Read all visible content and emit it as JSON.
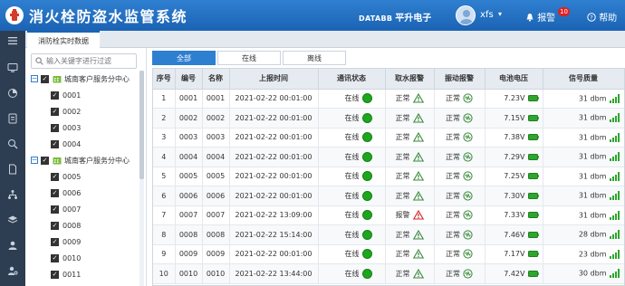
{
  "header": {
    "app_title": "消火栓防盗水监管系统",
    "brand_en": "DATABB",
    "brand_cn": "平升电子",
    "username": "xfs",
    "alarm_label": "报警",
    "alarm_count": "10",
    "help_label": "帮助",
    "icons": {
      "logo": "hydrant-logo-icon",
      "user": "user-avatar-icon",
      "alarm": "bell-icon",
      "help": "question-circle-icon"
    }
  },
  "nav": {
    "items": [
      "menu-icon",
      "monitor-icon",
      "pie-chart-icon",
      "report-icon",
      "search-device-icon",
      "document-icon",
      "network-icon",
      "layers-icon",
      "user-icon",
      "settings-user-icon"
    ]
  },
  "tab": {
    "label": "消防栓实时数据"
  },
  "tree": {
    "search_placeholder": "输入关键字进行过滤",
    "nodes": [
      {
        "label": "城南客户服务分中心",
        "type": "group"
      },
      {
        "label": "0001",
        "type": "leaf"
      },
      {
        "label": "0002",
        "type": "leaf"
      },
      {
        "label": "0003",
        "type": "leaf"
      },
      {
        "label": "0004",
        "type": "leaf"
      },
      {
        "label": "城南客户服务分中心",
        "type": "group"
      },
      {
        "label": "0005",
        "type": "leaf"
      },
      {
        "label": "0006",
        "type": "leaf"
      },
      {
        "label": "0007",
        "type": "leaf"
      },
      {
        "label": "0008",
        "type": "leaf"
      },
      {
        "label": "0009",
        "type": "leaf"
      },
      {
        "label": "0010",
        "type": "leaf"
      },
      {
        "label": "0011",
        "type": "leaf"
      }
    ]
  },
  "filters": {
    "all": "全部",
    "online": "在线",
    "offline": "离线",
    "active": "all"
  },
  "table": {
    "columns": [
      "序号",
      "编号",
      "名称",
      "上报时间",
      "通讯状态",
      "取水报警",
      "振动报警",
      "电池电压",
      "信号质量"
    ],
    "rows": [
      {
        "seq": "1",
        "code": "0001",
        "name": "0001",
        "time": "2021-02-22 00:01:00",
        "comm": "在线",
        "water": "正常",
        "water_alarm": false,
        "vib": "正常",
        "voltage": "7.23V",
        "signal": "31 dbm"
      },
      {
        "seq": "2",
        "code": "0002",
        "name": "0002",
        "time": "2021-02-22 00:01:00",
        "comm": "在线",
        "water": "正常",
        "water_alarm": false,
        "vib": "正常",
        "voltage": "7.15V",
        "signal": "31 dbm"
      },
      {
        "seq": "3",
        "code": "0003",
        "name": "0003",
        "time": "2021-02-22 00:01:00",
        "comm": "在线",
        "water": "正常",
        "water_alarm": false,
        "vib": "正常",
        "voltage": "7.38V",
        "signal": "31 dbm"
      },
      {
        "seq": "4",
        "code": "0004",
        "name": "0004",
        "time": "2021-02-22 00:01:00",
        "comm": "在线",
        "water": "正常",
        "water_alarm": false,
        "vib": "正常",
        "voltage": "7.29V",
        "signal": "31 dbm"
      },
      {
        "seq": "5",
        "code": "0005",
        "name": "0005",
        "time": "2021-02-22 00:01:00",
        "comm": "在线",
        "water": "正常",
        "water_alarm": false,
        "vib": "正常",
        "voltage": "7.25V",
        "signal": "31 dbm"
      },
      {
        "seq": "6",
        "code": "0006",
        "name": "0006",
        "time": "2021-02-22 00:01:00",
        "comm": "在线",
        "water": "正常",
        "water_alarm": false,
        "vib": "正常",
        "voltage": "7.30V",
        "signal": "31 dbm"
      },
      {
        "seq": "7",
        "code": "0007",
        "name": "0007",
        "time": "2021-02-22 13:09:00",
        "comm": "在线",
        "water": "报警",
        "water_alarm": true,
        "vib": "正常",
        "voltage": "7.33V",
        "signal": "31 dbm"
      },
      {
        "seq": "8",
        "code": "0008",
        "name": "0008",
        "time": "2021-02-22 15:14:00",
        "comm": "在线",
        "water": "正常",
        "water_alarm": false,
        "vib": "正常",
        "voltage": "7.46V",
        "signal": "28 dbm"
      },
      {
        "seq": "9",
        "code": "0009",
        "name": "0009",
        "time": "2021-02-22 00:01:00",
        "comm": "在线",
        "water": "正常",
        "water_alarm": false,
        "vib": "正常",
        "voltage": "7.17V",
        "signal": "23 dbm"
      },
      {
        "seq": "10",
        "code": "0010",
        "name": "0010",
        "time": "2021-02-22 13:44:00",
        "comm": "在线",
        "water": "正常",
        "water_alarm": false,
        "vib": "正常",
        "voltage": "7.42V",
        "signal": "30 dbm"
      }
    ]
  },
  "colors": {
    "header": "#1b63b4",
    "online": "#1ea61e",
    "alarm": "#e02020",
    "normal_icon": "#3a8a3a",
    "battery": "#2ea62e",
    "nav_bg": "#2e3e52",
    "active_filter": "#2f7fd0"
  }
}
